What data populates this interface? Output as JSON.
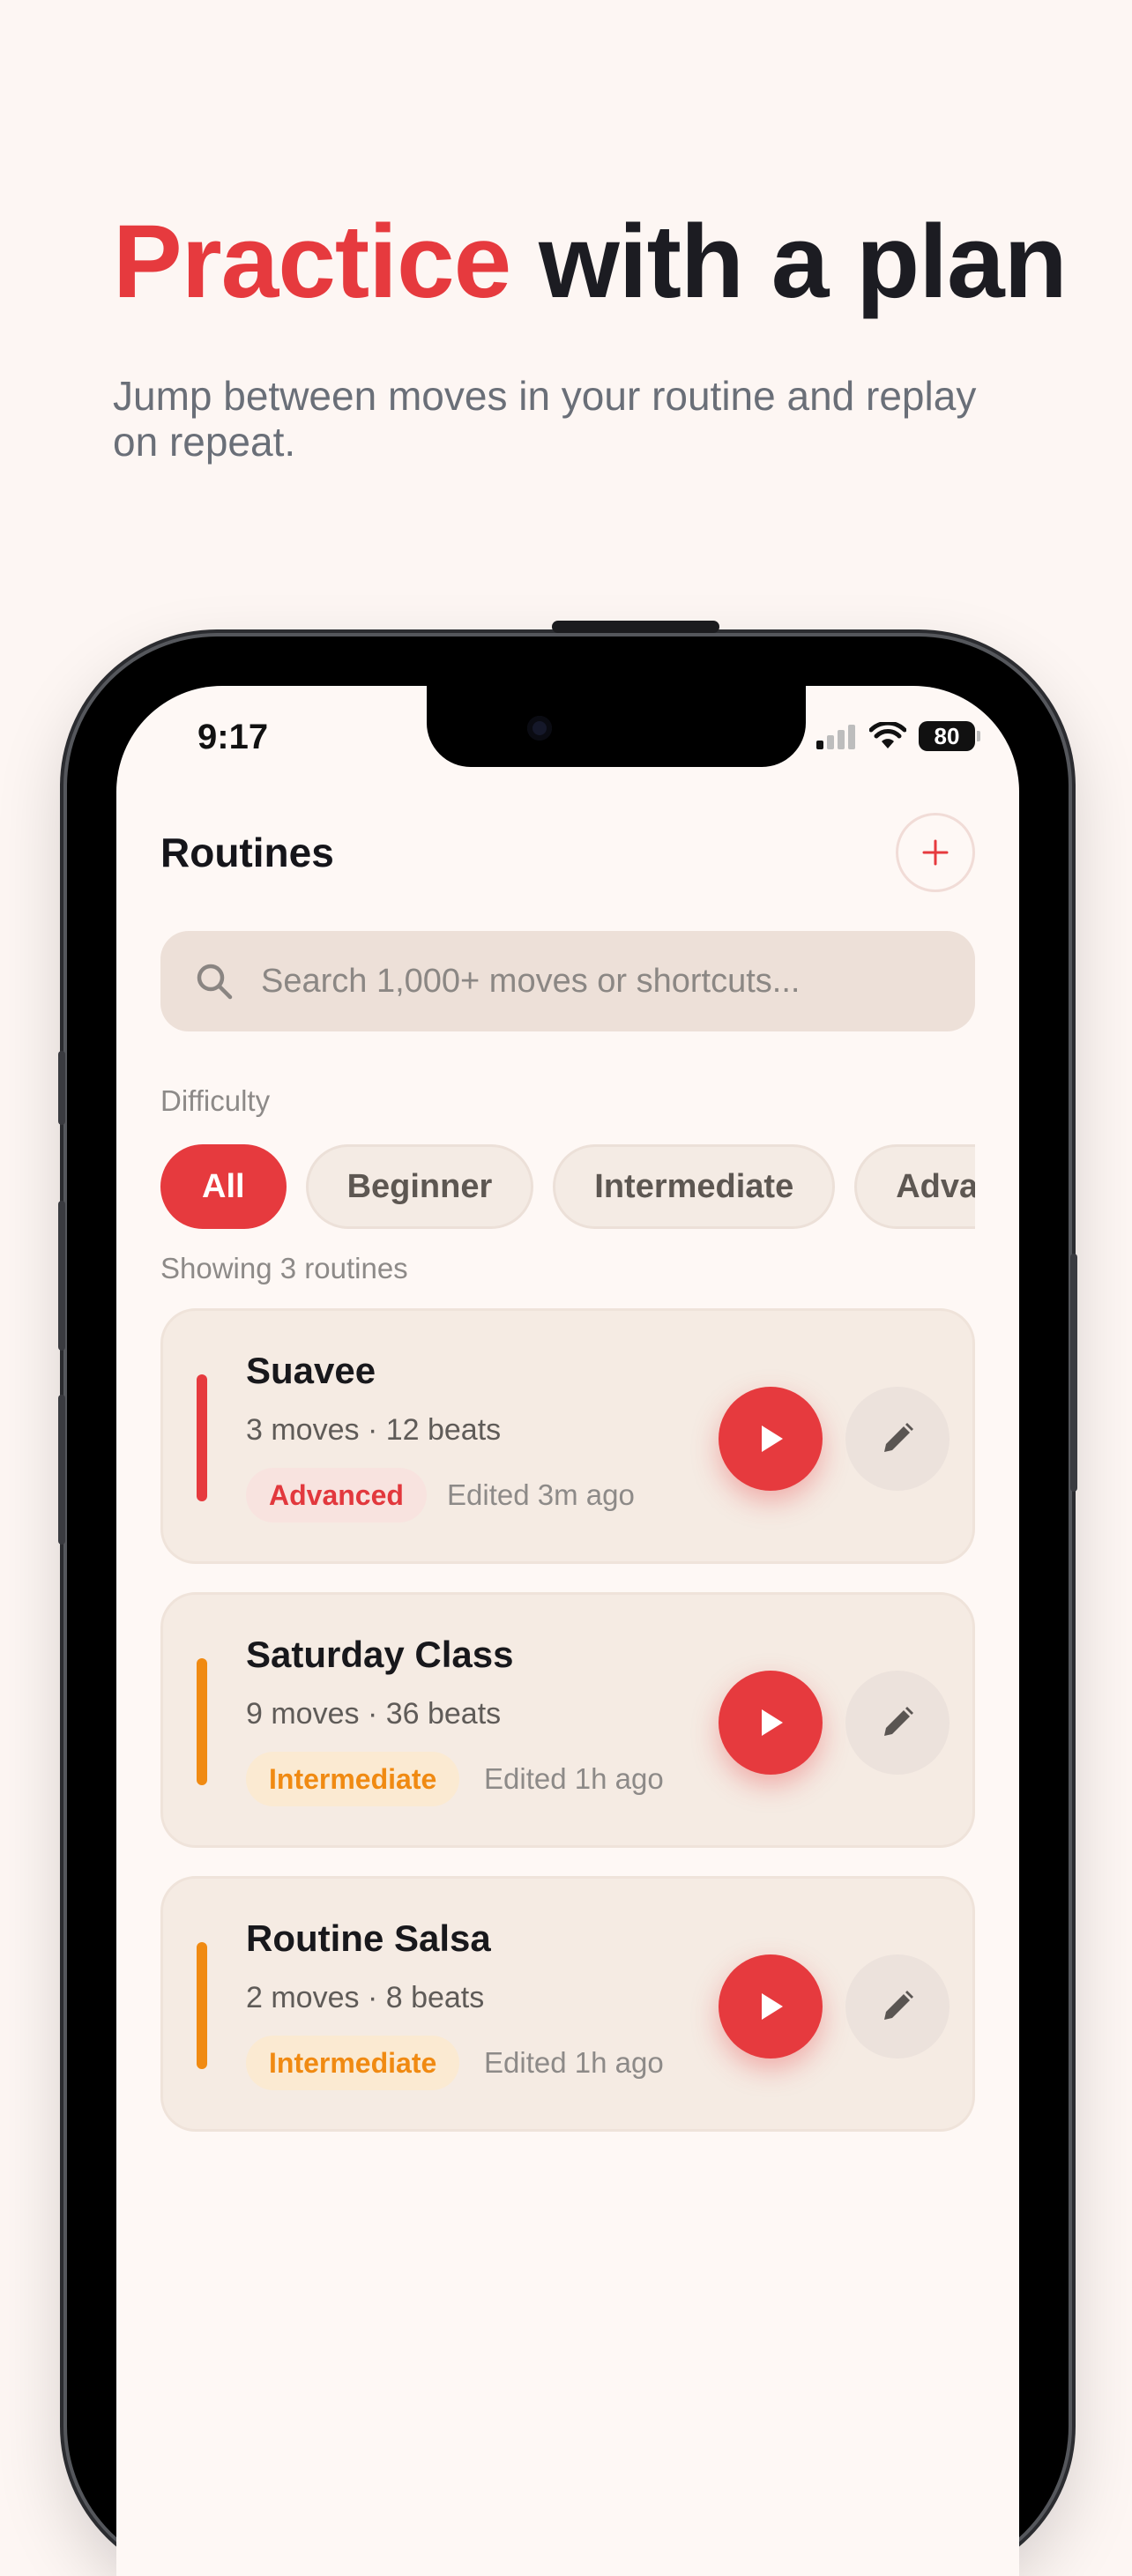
{
  "hero": {
    "title_accent": "Practice",
    "title_rest": " with a plan",
    "subtitle": "Jump between moves in your routine and replay on repeat."
  },
  "status_bar": {
    "time": "9:17",
    "battery": "80"
  },
  "app": {
    "title": "Routines",
    "add_icon": "plus-icon",
    "search": {
      "placeholder": "Search 1,000+ moves or shortcuts...",
      "value": ""
    },
    "filters": {
      "label": "Difficulty",
      "chips": [
        "All",
        "Beginner",
        "Intermediate",
        "Advanced"
      ],
      "selected": "All"
    },
    "count_label": "Showing 3 routines",
    "routines": [
      {
        "name": "Suavee",
        "meta": "3 moves · 12 beats",
        "difficulty": "Advanced",
        "edited": "Edited 3m ago"
      },
      {
        "name": "Saturday Class",
        "meta": "9 moves · 36 beats",
        "difficulty": "Intermediate",
        "edited": "Edited 1h ago"
      },
      {
        "name": "Routine Salsa",
        "meta": "2 moves · 8 beats",
        "difficulty": "Intermediate",
        "edited": "Edited 1h ago"
      }
    ]
  },
  "colors": {
    "accent": "#e63a3e",
    "advanced": "#e2383d",
    "intermediate": "#f08a12",
    "page_background": "#fdf6f3",
    "card_background": "#f5ebe3"
  }
}
